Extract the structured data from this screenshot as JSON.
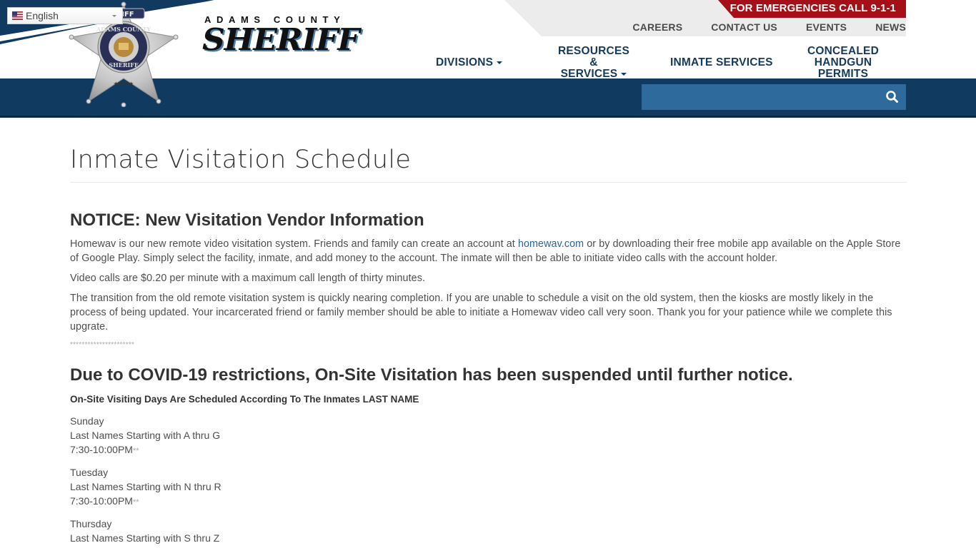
{
  "header": {
    "language_selector": {
      "value": "English",
      "flag": "us-flag-icon"
    },
    "logo": {
      "top_text": "ADAMS COUNTY",
      "main_text": "SHERIFF"
    },
    "badge": {
      "ribbon_text": "SHERIFF",
      "ring_top": "ADAMS COUNTY",
      "ring_bottom": "SHERIFF"
    },
    "emergency_banner": "FOR EMERGENCIES CALL 9-1-1",
    "utility_nav": [
      {
        "label": "CAREERS"
      },
      {
        "label": "CONTACT US"
      },
      {
        "label": "EVENTS"
      },
      {
        "label": "NEWS"
      }
    ],
    "main_nav": [
      {
        "label": "DIVISIONS",
        "dropdown": true
      },
      {
        "label_line1": "RESOURCES &",
        "label_line2": "SERVICES",
        "dropdown": true
      },
      {
        "label": "INMATE SERVICES",
        "dropdown": false
      },
      {
        "label_line1": "CONCEALED",
        "label_line2": "HANDGUN PERMITS",
        "dropdown": false
      }
    ],
    "search": {
      "placeholder": "",
      "value": "",
      "icon": "search-icon"
    },
    "colors": {
      "navy": "#113a60",
      "search_bg": "#2e6a9c",
      "emergency_red": "#a50f17",
      "utility_gray": "#ececec",
      "nav_text": "#143a5e"
    }
  },
  "page": {
    "title": "Inmate Visitation Schedule",
    "notice_heading": "NOTICE: New Visitation Vendor Information",
    "paragraph1_before": "Homewav is our new remote video visitation system. Friends and family can create an account at ",
    "paragraph1_link": "homewav.com",
    "paragraph1_after": " or by downloading their free mobile app available on the Apple Store of Google Play. Simply select the facility, inmate, and add money to the account. The inmate will then be able to initiate video calls with the account holder.",
    "paragraph2": "Video calls are $0.20 per minute with a maximum call length of thirty minutes.",
    "paragraph3": "The transition from the old remote visitation system is quickly nearing completion. If you are unable to schedule a visit on the old system, then the kiosks are mostly likely in the process of being updated. Your incarcerated friend or family member should be able to initiate a Homewav video call very soon. Thank you for your patience while we complete this upgrate.",
    "separator": "**********************",
    "covid_heading": "Due to COVID-19 restrictions, On-Site Visitation has been suspended until further notice.",
    "schedule_heading": "On-Site Visiting Days Are Scheduled According To The Inmates LAST NAME",
    "schedule": [
      {
        "day": "Sunday",
        "names": "Last Names Starting with A thru G",
        "hours": "7:30-10:00PM",
        "hours_suffix": "**"
      },
      {
        "day": "Tuesday",
        "names": "Last Names Starting with N thru R",
        "hours": "7:30-10:00PM",
        "hours_suffix": "**"
      },
      {
        "day": "Thursday",
        "names": "Last Names Starting with S thru Z"
      }
    ],
    "link_color": "#2a6496"
  }
}
